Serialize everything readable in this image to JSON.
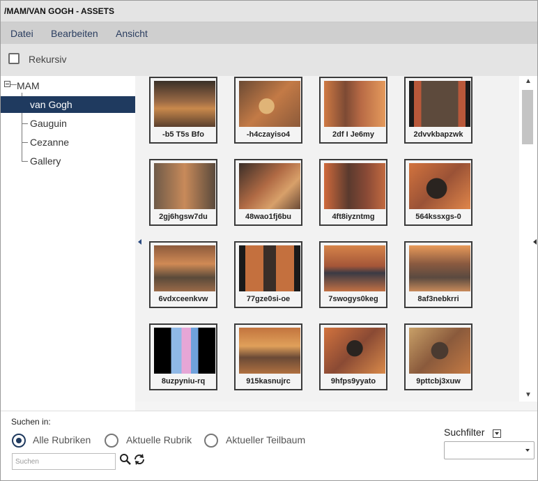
{
  "window": {
    "title": "/MAM/VAN GOGH - ASSETS"
  },
  "menu": {
    "items": [
      "Datei",
      "Bearbeiten",
      "Ansicht"
    ]
  },
  "toolbar": {
    "recursive_label": "Rekursiv",
    "recursive_checked": false
  },
  "tree": {
    "root": "MAM",
    "children": [
      "van Gogh",
      "Gauguin",
      "Cezanne",
      "Gallery"
    ],
    "selected": "van Gogh"
  },
  "gallery": {
    "items": [
      "-b5 T5s Bfo",
      "-h4czayiso4",
      "2df I Je6my",
      "2dvvkbapzwk",
      "2gj6hgsw7du",
      "48wao1fj6bu",
      "4ft8iyzntmg",
      "564kssxgs-0",
      "6vdxceenkvw",
      "77gze0si-oe",
      "7swogys0keg",
      "8af3nebkrri",
      "8uzpyniu-rq",
      "915kasnujrc",
      "9hfps9yyato",
      "9pttcbj3xuw"
    ]
  },
  "search": {
    "label": "Suchen in:",
    "options": [
      "Alle Rubriken",
      "Aktuelle Rubrik",
      "Aktueller Teilbaum"
    ],
    "selected": "Alle Rubriken",
    "placeholder": "Suchen",
    "value": ""
  },
  "filter": {
    "label": "Suchfilter",
    "value": ""
  },
  "colors": {
    "accent": "#1f3a5f",
    "menu_bg": "#cfcfcf",
    "thumb_border": "#3a3a3a"
  },
  "icons": [
    "search-icon",
    "refresh-icon",
    "scroll-up-icon",
    "scroll-down-icon",
    "collapse-minus-icon",
    "dropdown-caret-icon"
  ]
}
